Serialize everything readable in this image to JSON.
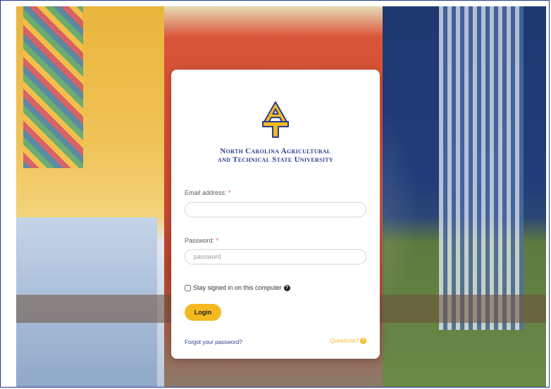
{
  "login": {
    "university_name_line1": "North Carolina Agricultural",
    "university_name_line2": "and Technical State University",
    "email_label": "Email address:",
    "password_label": "Password:",
    "required_marker": "*",
    "email_placeholder": "",
    "password_placeholder": "password",
    "stay_signed_in_label": "Stay signed in on this computer",
    "login_button": "Login",
    "forgot_password": "Forgot your password?",
    "questions": "Questions?"
  },
  "icons": {
    "help": "question-circle-icon",
    "logo": "ncat-logo-icon"
  },
  "colors": {
    "accent_gold": "#f5b920",
    "brand_blue": "#2b3f8f",
    "required_red": "#d9534f"
  }
}
